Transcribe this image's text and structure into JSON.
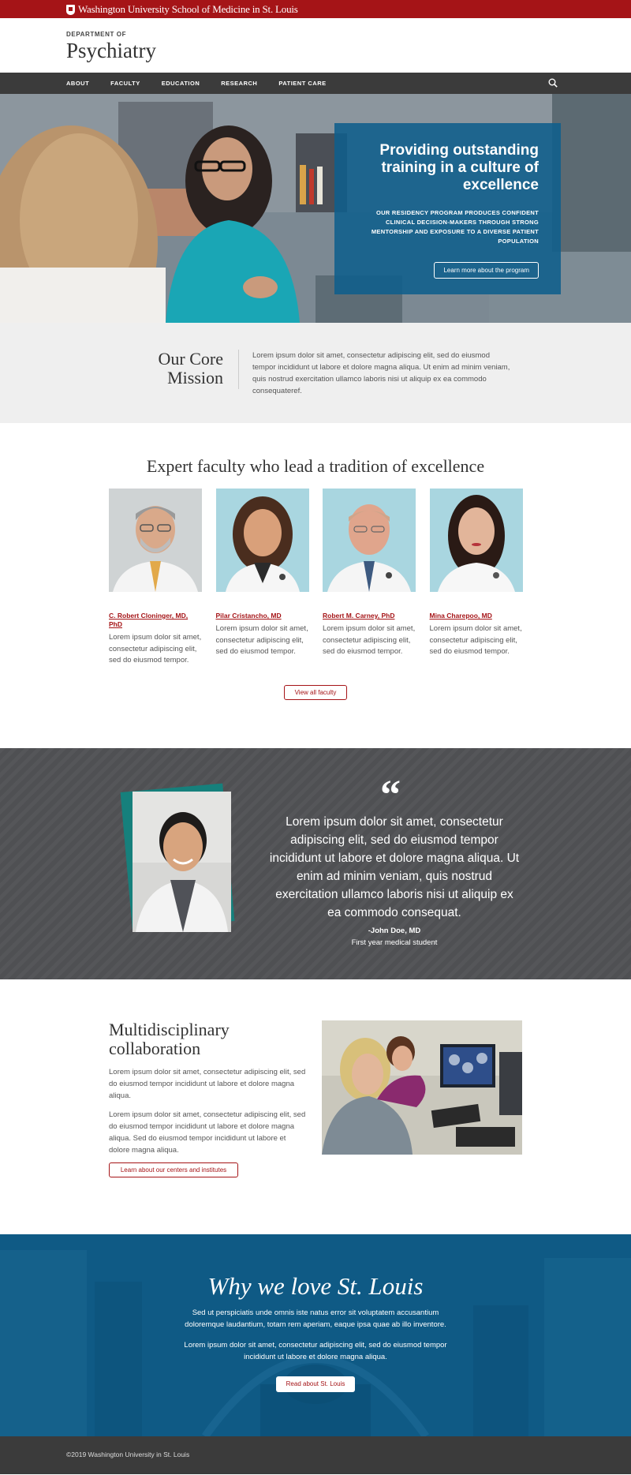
{
  "topbar": {
    "brand": "Washington University School of Medicine in St. Louis"
  },
  "header": {
    "dept_label": "DEPARTMENT OF",
    "title": "Psychiatry"
  },
  "nav": {
    "items": [
      "ABOUT",
      "FACULTY",
      "EDUCATION",
      "RESEARCH",
      "PATIENT CARE"
    ],
    "search_icon": "search-icon"
  },
  "hero": {
    "heading": "Providing outstanding training in a culture of excellence",
    "subtext": "OUR RESIDENCY PROGRAM PRODUCES CONFIDENT CLINICAL DECISION-MAKERS THROUGH STRONG MENTORSHIP AND EXPOSURE TO A DIVERSE PATIENT POPULATION",
    "button": "Learn more about the program"
  },
  "mission": {
    "heading": "Our Core Mission",
    "text": "Lorem ipsum dolor sit amet, consectetur adipiscing elit, sed do eiusmod tempor incididunt ut labore et dolore magna aliqua. Ut enim ad minim veniam, quis nostrud exercitation ullamco laboris nisi ut aliquip ex ea commodo consequateref."
  },
  "faculty": {
    "heading": "Expert faculty who lead a tradition of excellence",
    "members": [
      {
        "name": "C. Robert Cloninger, MD, PhD",
        "bio": "Lorem ipsum dolor sit amet, consectetur adipiscing elit, sed do eiusmod tempor."
      },
      {
        "name": "Pilar Cristancho, MD",
        "bio": "Lorem ipsum dolor sit amet, consectetur adipiscing elit, sed do eiusmod tempor."
      },
      {
        "name": "Robert M. Carney, PhD",
        "bio": "Lorem ipsum dolor sit amet, consectetur adipiscing elit, sed do eiusmod tempor."
      },
      {
        "name": "Mina Charepoo, MD",
        "bio": "Lorem ipsum dolor sit amet, consectetur adipiscing elit, sed do eiusmod tempor."
      }
    ],
    "button": "View all faculty"
  },
  "quote": {
    "mark": "“",
    "text": "Lorem ipsum dolor sit amet, consectetur adipiscing elit, sed do eiusmod tempor incididunt ut labore et dolore magna aliqua. Ut enim ad minim veniam, quis nostrud exercitation ullamco laboris nisi ut aliquip ex ea commodo consequat.",
    "author": "-John Doe, MD",
    "role": "First year medical student"
  },
  "collab": {
    "heading": "Multidisciplinary collaboration",
    "p1": "Lorem ipsum dolor sit amet, consectetur adipiscing elit, sed do eiusmod tempor incididunt ut labore et dolore magna aliqua.",
    "p2": "Lorem ipsum dolor sit amet, consectetur adipiscing elit, sed do eiusmod tempor incididunt ut labore et dolore magna aliqua.  Sed do eiusmod tempor incididunt ut labore et dolore magna aliqua.",
    "button": "Learn about our centers and institutes"
  },
  "stlouis": {
    "heading": "Why we love St. Louis",
    "p1": "Sed ut perspiciatis unde omnis iste natus error sit voluptatem accusantium doloremque laudantium, totam rem aperiam, eaque ipsa quae ab illo inventore.",
    "p2": "Lorem ipsum dolor sit amet, consectetur adipiscing elit, sed do eiusmod tempor incididunt ut labore et dolore magna aliqua.",
    "button": "Read about St. Louis"
  },
  "footer": {
    "copyright": "©2019 Washington University in St. Louis"
  },
  "colors": {
    "brand_red": "#a51417",
    "nav_gray": "#3b3b3b",
    "hero_blue": "#0f5f8c",
    "quote_bg": "#4f5053",
    "teal_frame": "#16807c"
  }
}
